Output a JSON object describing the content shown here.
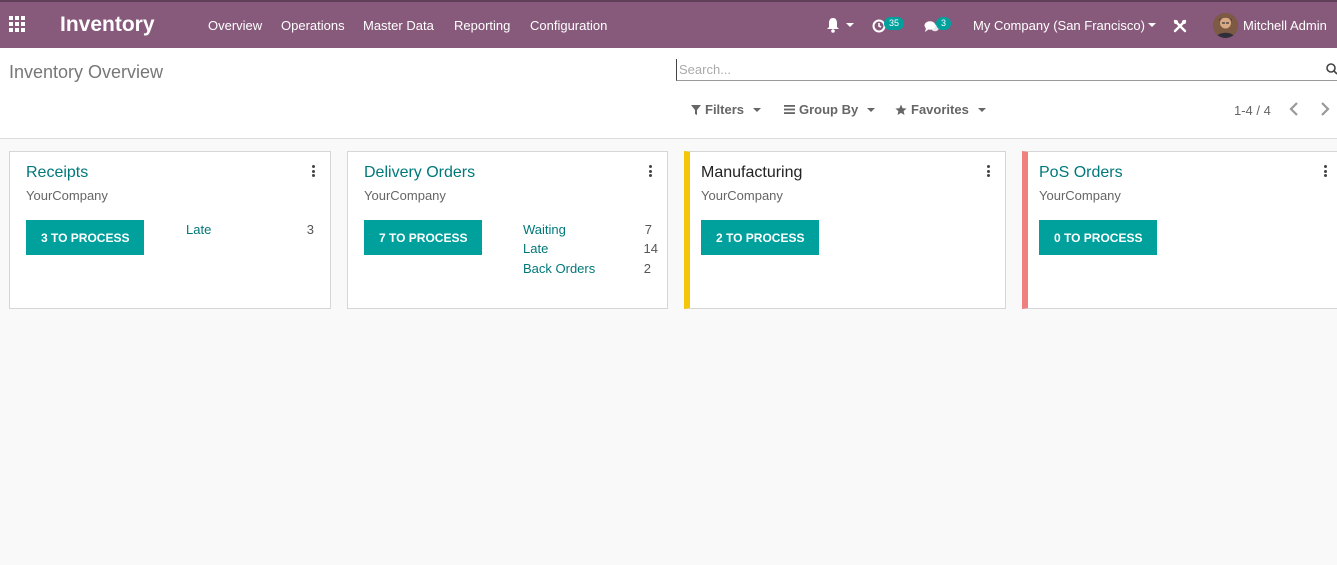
{
  "navbar": {
    "app_title": "Inventory",
    "menus": [
      "Overview",
      "Operations",
      "Master Data",
      "Reporting",
      "Configuration"
    ],
    "activity_count": "35",
    "message_count": "3",
    "company": "My Company (San Francisco)",
    "user": "Mitchell Admin",
    "accent": "#875a7b"
  },
  "control_panel": {
    "title": "Inventory Overview",
    "search_placeholder": "Search...",
    "filters_label": "Filters",
    "group_by_label": "Group By",
    "favorites_label": "Favorites",
    "pager": "1-4 / 4"
  },
  "cards": [
    {
      "title": "Receipts",
      "company": "YourCompany",
      "button": "3 TO PROCESS",
      "stats": [
        {
          "label": "Late",
          "value": "3"
        }
      ]
    },
    {
      "title": "Delivery Orders",
      "company": "YourCompany",
      "button": "7 TO PROCESS",
      "stats": [
        {
          "label": "Waiting",
          "value": "7"
        },
        {
          "label": "Late",
          "value": "14"
        },
        {
          "label": "Back Orders",
          "value": "2"
        }
      ]
    },
    {
      "title": "Manufacturing",
      "company": "YourCompany",
      "button": "2 TO PROCESS",
      "stats": [],
      "stripe_color": "#f4c609"
    },
    {
      "title": "PoS Orders",
      "company": "YourCompany",
      "button": "0 TO PROCESS",
      "stats": [],
      "stripe_color": "#f06050"
    }
  ]
}
